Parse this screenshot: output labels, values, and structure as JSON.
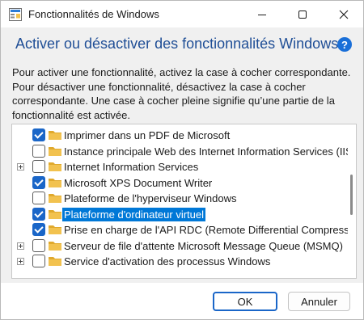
{
  "window": {
    "title": "Fonctionnalités de Windows",
    "controls": [
      "minimize",
      "maximize",
      "close"
    ]
  },
  "main": {
    "heading": "Activer ou désactiver des fonctionnalités Windows",
    "help_label": "?",
    "description": "Pour activer une fonctionnalité, activez la case à cocher correspondante. Pour désactiver une fonctionnalité, désactivez la case à cocher correspondante. Une case à cocher pleine signifie qu’une partie de la fonctionnalité est activée."
  },
  "features": [
    {
      "label": "Imprimer dans un PDF de Microsoft",
      "checked": true,
      "expandable": false,
      "selected": false
    },
    {
      "label": "Instance principale Web des Internet Information Services (IIS",
      "checked": false,
      "expandable": false,
      "selected": false
    },
    {
      "label": "Internet Information Services",
      "checked": false,
      "expandable": true,
      "selected": false
    },
    {
      "label": "Microsoft XPS Document Writer",
      "checked": true,
      "expandable": false,
      "selected": false
    },
    {
      "label": "Plateforme de l'hyperviseur Windows",
      "checked": false,
      "expandable": false,
      "selected": false
    },
    {
      "label": "Plateforme d'ordinateur virtuel",
      "checked": true,
      "expandable": false,
      "selected": true
    },
    {
      "label": "Prise en charge de l'API RDC (Remote Differential Compressi",
      "checked": true,
      "expandable": false,
      "selected": false
    },
    {
      "label": "Serveur de file d'attente Microsoft Message Queue (MSMQ)",
      "checked": false,
      "expandable": true,
      "selected": false
    },
    {
      "label": "Service d'activation des processus Windows",
      "checked": false,
      "expandable": true,
      "selected": false
    }
  ],
  "footer": {
    "ok_label": "OK",
    "cancel_label": "Annuler"
  },
  "colors": {
    "accent": "#1a66c8",
    "selection": "#0078d7",
    "heading": "#1f4e96",
    "folder": "#f2c24f"
  }
}
